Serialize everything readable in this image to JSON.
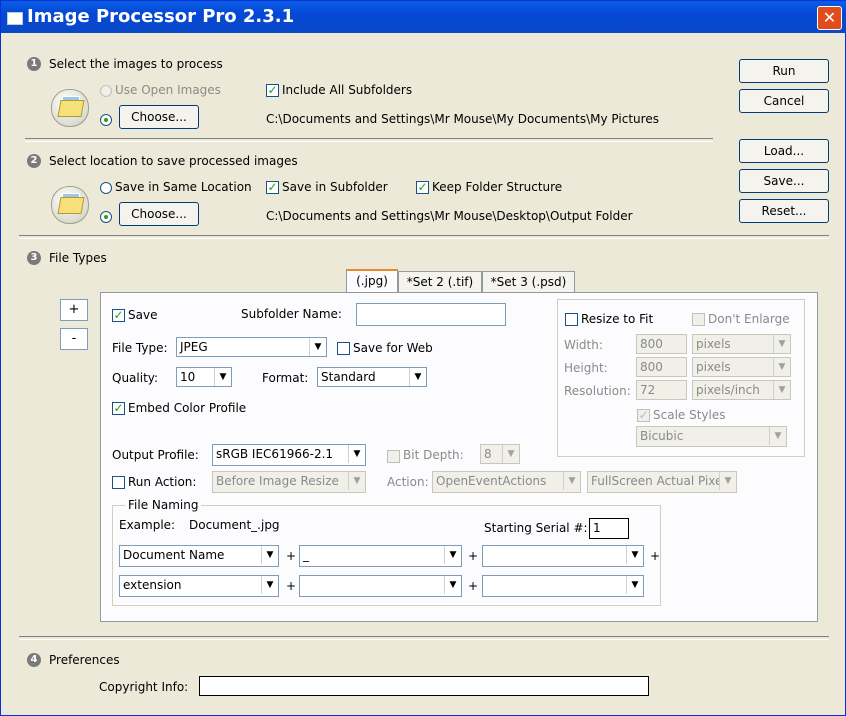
{
  "window": {
    "title": "Image Processor Pro 2.3.1",
    "close": "✕"
  },
  "section1": {
    "num": "1",
    "heading": "Select the images to process",
    "use_open": "Use Open Images",
    "include_sub": "Include All Subfolders",
    "choose": "Choose...",
    "path": "C:\\Documents and Settings\\Mr Mouse\\My Documents\\My Pictures"
  },
  "section2": {
    "num": "2",
    "heading": "Select location to save processed images",
    "same_loc": "Save in Same Location",
    "save_sub": "Save in Subfolder",
    "keep_struct": "Keep Folder Structure",
    "choose": "Choose...",
    "path": "C:\\Documents and Settings\\Mr Mouse\\Desktop\\Output Folder"
  },
  "section3": {
    "num": "3",
    "heading": "File Types"
  },
  "section4": {
    "num": "4",
    "heading": "Preferences",
    "copyright_label": "Copyright Info:",
    "copyright_value": ""
  },
  "buttons": {
    "run": "Run",
    "cancel": "Cancel",
    "load": "Load...",
    "save": "Save...",
    "reset": "Reset...",
    "plus": "+",
    "minus": "-"
  },
  "tabs": [
    {
      "label": "(.jpg)"
    },
    {
      "label": "*Set 2 (.tif)"
    },
    {
      "label": "*Set 3 (.psd)"
    }
  ],
  "filetype": {
    "save": "Save",
    "subfolder_label": "Subfolder Name:",
    "subfolder_value": "",
    "filetype_label": "File Type:",
    "filetype_value": "JPEG",
    "save_web": "Save for Web",
    "quality_label": "Quality:",
    "quality_value": "10",
    "format_label": "Format:",
    "format_value": "Standard",
    "embed": "Embed Color Profile",
    "output_label": "Output Profile:",
    "output_value": "sRGB IEC61966-2.1",
    "bitdepth_label": "Bit Depth:",
    "bitdepth_value": "8",
    "run_action": "Run Action:",
    "run_action_value": "Before Image Resize",
    "action_label": "Action:",
    "action_value": "OpenEventActions",
    "action2_value": "FullScreen Actual  Pixels"
  },
  "resize": {
    "fit": "Resize to Fit",
    "dont_enlarge": "Don't Enlarge",
    "width_label": "Width:",
    "width_value": "800",
    "width_unit": "pixels",
    "height_label": "Height:",
    "height_value": "800",
    "height_unit": "pixels",
    "res_label": "Resolution:",
    "res_value": "72",
    "res_unit": "pixels/inch",
    "scale": "Scale Styles",
    "method": "Bicubic"
  },
  "naming": {
    "legend": "File Naming",
    "example_label": "Example:",
    "example_value": "Document_.jpg",
    "serial_label": "Starting Serial #:",
    "serial_value": "1",
    "row1": [
      "Document Name",
      "_",
      ""
    ],
    "row2": [
      "extension",
      "",
      ""
    ],
    "plus": "+"
  },
  "colors": {
    "titlebar": "#0548d6",
    "accent_check": "#21a121",
    "tab_highlight": "#e68b2c"
  }
}
